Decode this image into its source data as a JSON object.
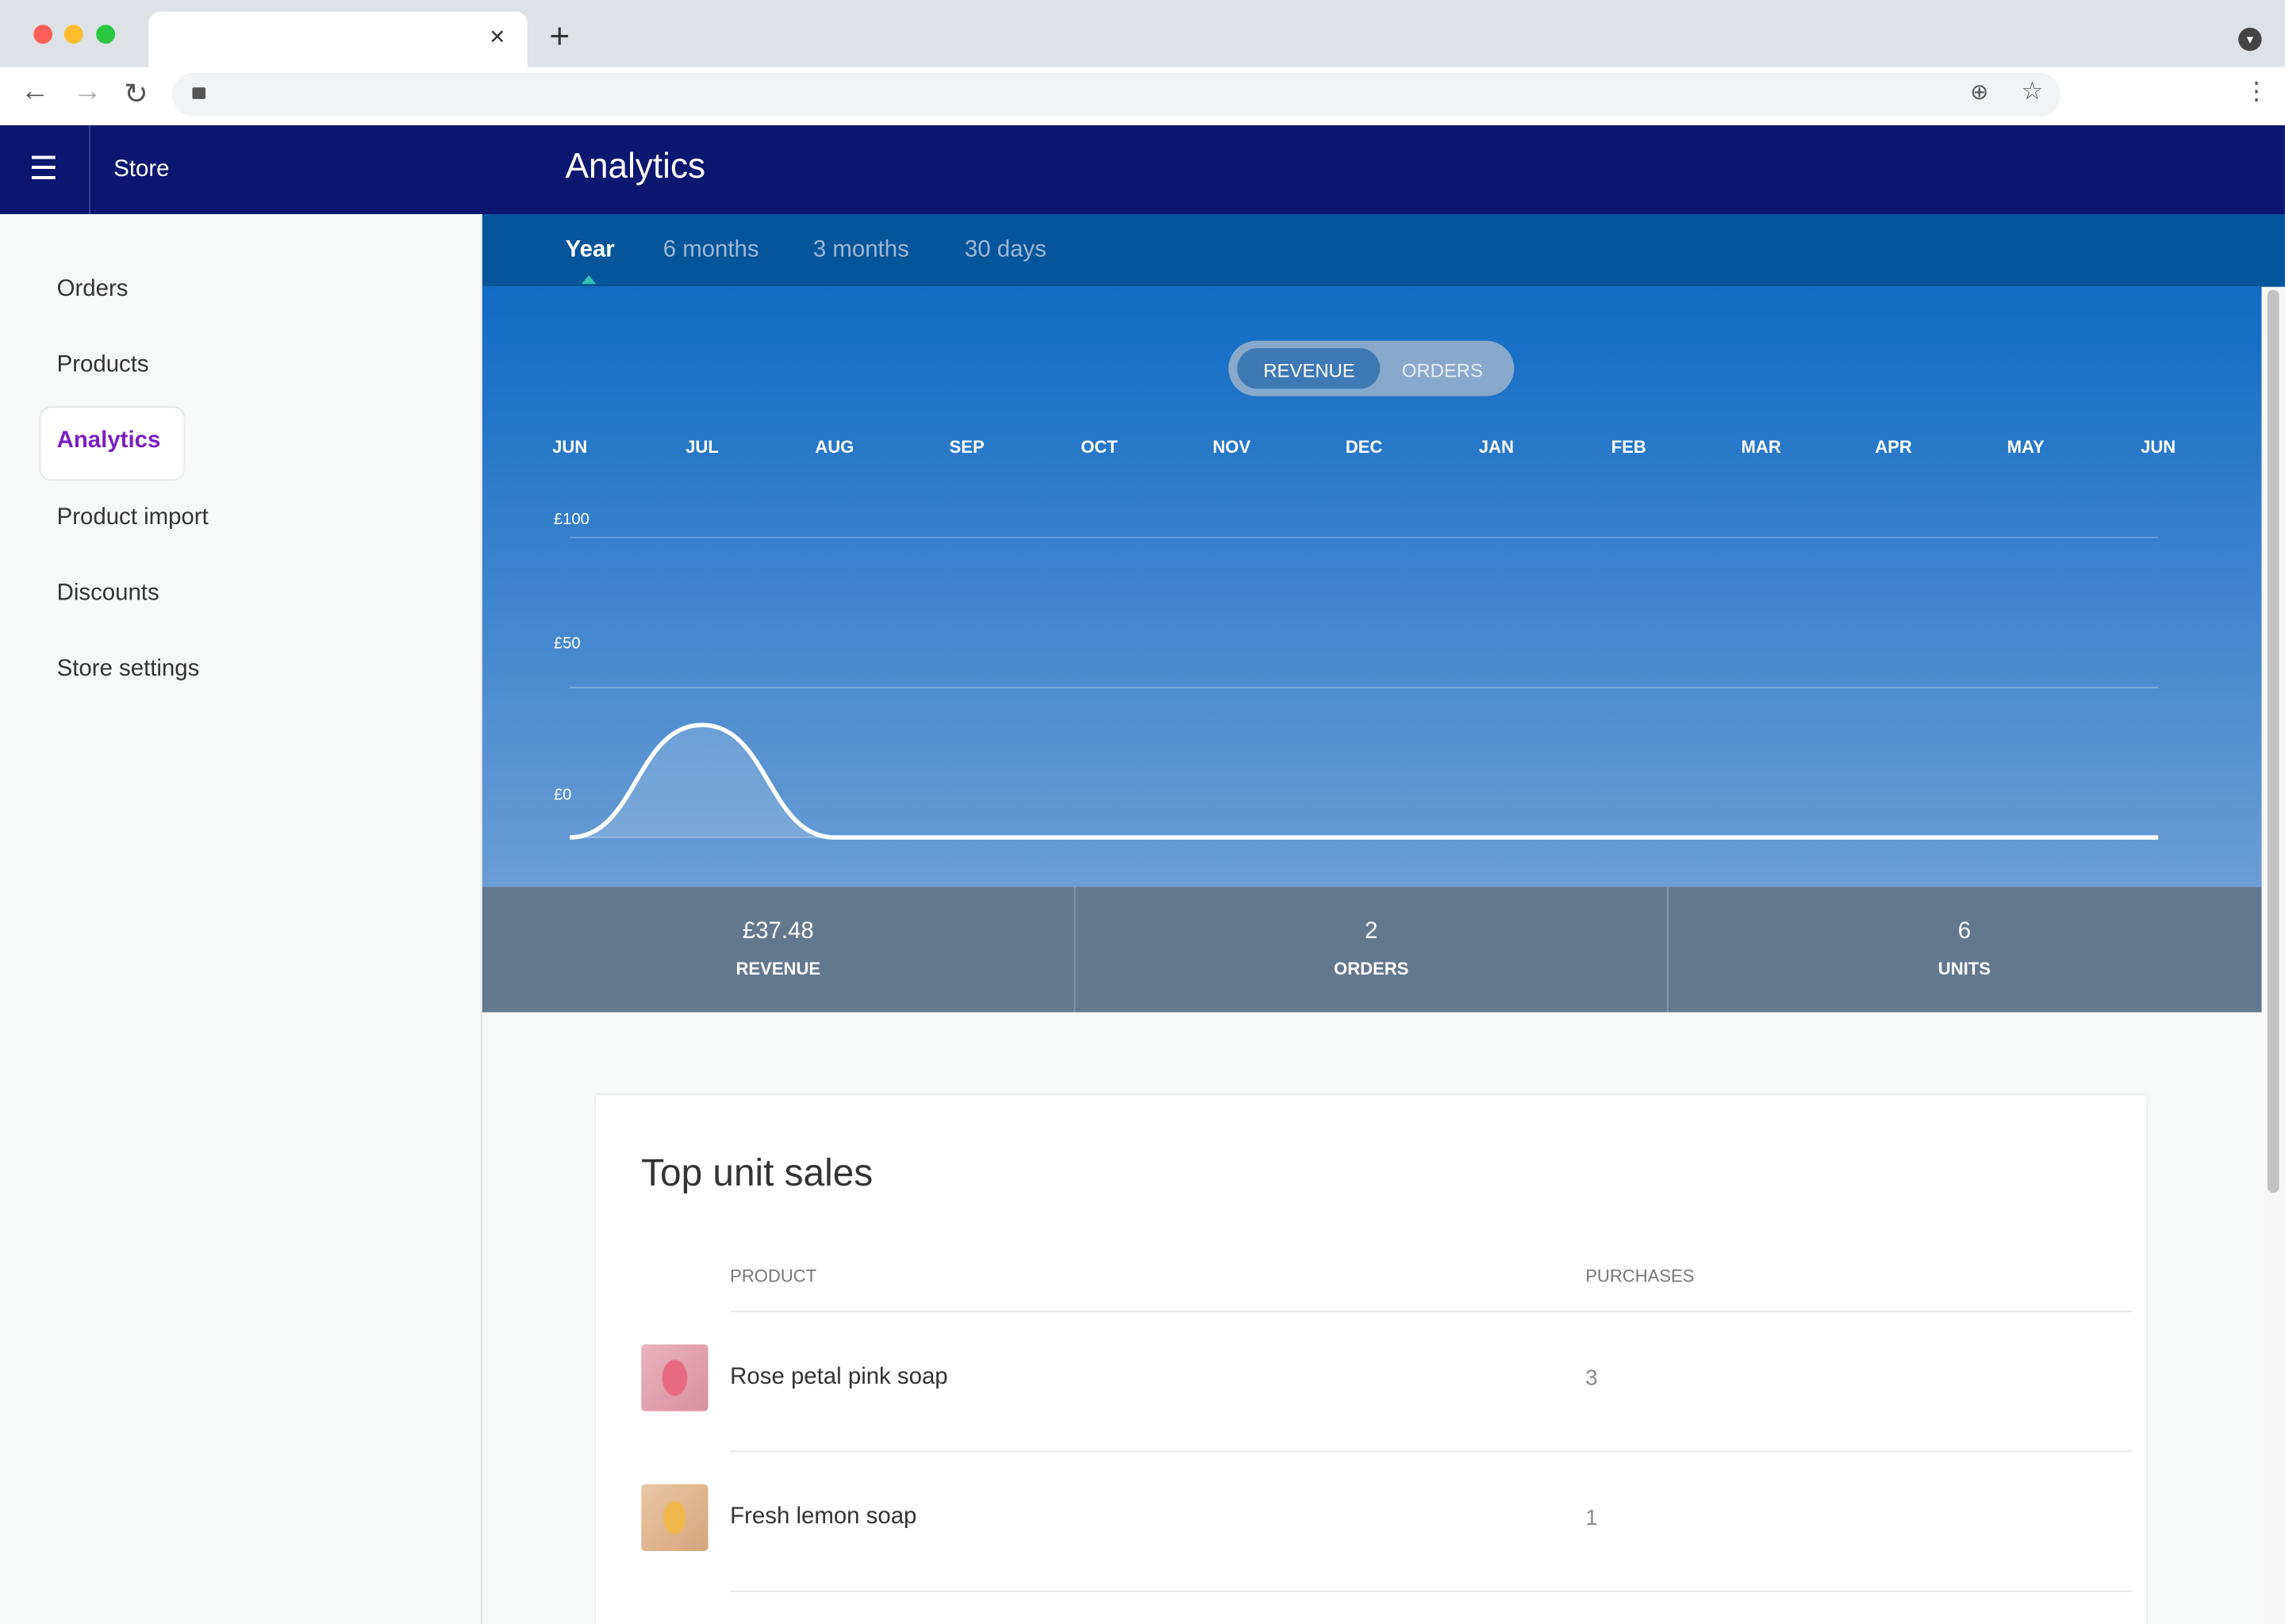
{
  "browser": {
    "tab_close": "×",
    "new_tab": "+",
    "tab_menu": "▾"
  },
  "app": {
    "store_label": "Store",
    "title": "Analytics"
  },
  "sidebar": {
    "items": [
      {
        "label": "Orders"
      },
      {
        "label": "Products"
      },
      {
        "label": "Analytics",
        "active": true
      },
      {
        "label": "Product import"
      },
      {
        "label": "Discounts"
      },
      {
        "label": "Store settings"
      }
    ]
  },
  "ranges": [
    {
      "label": "Year",
      "active": true
    },
    {
      "label": "6 months"
    },
    {
      "label": "3 months"
    },
    {
      "label": "30 days"
    }
  ],
  "toggle": {
    "revenue": "REVENUE",
    "orders": "ORDERS",
    "selected": "REVENUE"
  },
  "chart_data": {
    "type": "area",
    "categories": [
      "JUN",
      "JUL",
      "AUG",
      "SEP",
      "OCT",
      "NOV",
      "DEC",
      "JAN",
      "FEB",
      "MAR",
      "APR",
      "MAY",
      "JUN"
    ],
    "values": [
      0,
      37.48,
      0,
      0,
      0,
      0,
      0,
      0,
      0,
      0,
      0,
      0,
      0
    ],
    "yticks": [
      "£0",
      "£50",
      "£100"
    ],
    "ylim": [
      0,
      100
    ],
    "grid": true
  },
  "stats": [
    {
      "value": "£37.48",
      "label": "REVENUE"
    },
    {
      "value": "2",
      "label": "ORDERS"
    },
    {
      "value": "6",
      "label": "UNITS"
    }
  ],
  "top_sales": {
    "title": "Top unit sales",
    "columns": [
      "PRODUCT",
      "PURCHASES"
    ],
    "rows": [
      {
        "product": "Rose petal pink soap",
        "purchases": "3",
        "color": "#e86a80"
      },
      {
        "product": "Fresh lemon soap",
        "purchases": "1",
        "color": "#f0b84c"
      }
    ]
  },
  "colors": {
    "appbar": "#0c1770",
    "accent": "#7b1fc2",
    "range_bar": "#04559a"
  }
}
